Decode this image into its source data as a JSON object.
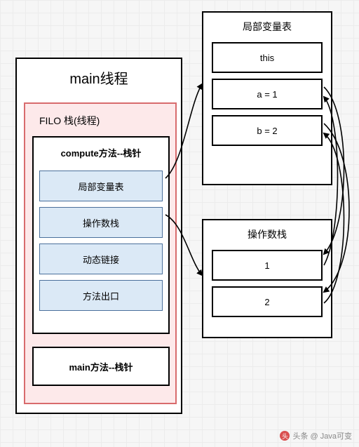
{
  "main_thread": {
    "title": "main线程"
  },
  "filo": {
    "title": "FILO  栈(线程)"
  },
  "compute_frame": {
    "title": "compute方法--栈针",
    "slots": [
      "局部变量表",
      "操作数栈",
      "动态链接",
      "方法出口"
    ]
  },
  "main_frame": {
    "title": "main方法--栈针"
  },
  "local_var_table": {
    "title": "局部变量表",
    "cells": [
      "this",
      "a = 1",
      "b = 2"
    ]
  },
  "operand_stack": {
    "title": "操作数栈",
    "cells": [
      "1",
      "2"
    ]
  },
  "watermark": {
    "text": "头条 @ Java可变"
  }
}
